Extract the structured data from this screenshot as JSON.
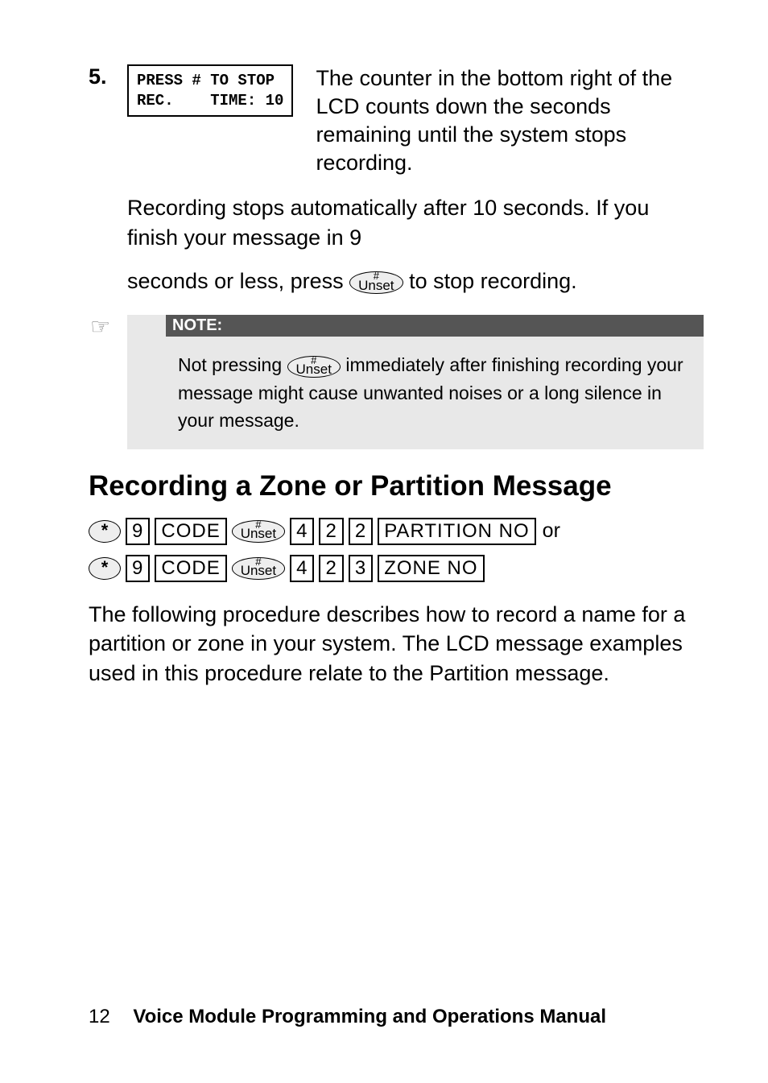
{
  "step": {
    "number": "5.",
    "lcd_line1": "PRESS # TO STOP",
    "lcd_line2": "REC.    TIME: 10",
    "description": "The counter in the bottom right of the LCD counts down the seconds remaining until the system stops recording."
  },
  "para1": "Recording stops automatically after 10 seconds. If you finish your message in 9",
  "para2_a": "seconds or less, press ",
  "para2_b": " to stop recording.",
  "unset_key": {
    "hash": "#",
    "label": "Unset"
  },
  "note": {
    "header": "NOTE:",
    "body_a": "Not pressing ",
    "body_b": " immediately after finishing recording your message might cause unwanted noises or a long silence in your message."
  },
  "heading": "Recording a Zone or Partition Message",
  "seq1": {
    "star": "*",
    "k1": "9",
    "k2": "CODE",
    "k3": "4",
    "k4": "2",
    "k5": "2",
    "k6": "PARTITION NO",
    "trail": "or"
  },
  "seq2": {
    "star": "*",
    "k1": "9",
    "k2": "CODE",
    "k3": "4",
    "k4": "2",
    "k5": "3",
    "k6": "ZONE NO"
  },
  "proc_para": "The following procedure describes how to record a name for a partition or zone in your system. The LCD message examples used in this procedure relate to the Partition message.",
  "footer": {
    "page": "12",
    "title": "Voice Module Programming and Operations Manual"
  }
}
